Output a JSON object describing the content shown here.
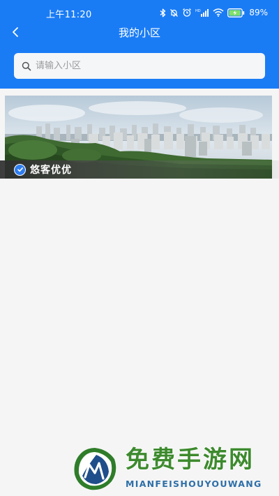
{
  "status_bar": {
    "time": "上午11:20",
    "battery_percent": "89%",
    "icons": [
      "bluetooth-icon",
      "mute-icon",
      "alarm-icon",
      "hd-signal-icon",
      "wifi-icon",
      "battery-charging-icon"
    ]
  },
  "nav": {
    "title": "我的小区",
    "back_icon": "chevron-left-icon"
  },
  "search": {
    "placeholder": "请输入小区",
    "value": "",
    "icon": "search-icon"
  },
  "communities": [
    {
      "name": "悠客优优",
      "selected": true,
      "selected_icon": "check-circle-icon"
    }
  ],
  "watermark": {
    "title": "免费手游网",
    "subtitle": "MIANFEISHOUYOUWANG"
  },
  "colors": {
    "header_blue": "#1a7cf5",
    "page_bg": "#f5f5f5",
    "check_blue": "#2f7ef0",
    "watermark_green": "#3d8a2e",
    "watermark_blue": "#2e6fa8"
  }
}
